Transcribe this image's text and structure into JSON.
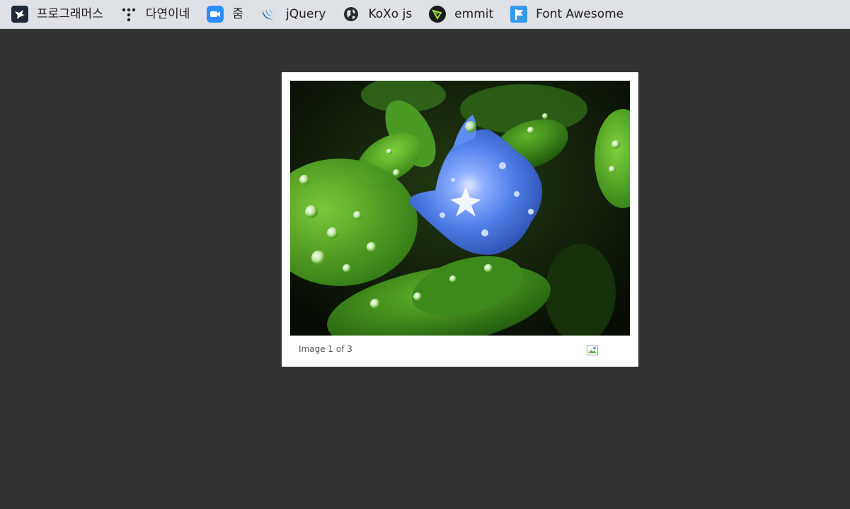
{
  "bookmarks": [
    {
      "label": "프로그래머스",
      "icon": "programmers-icon"
    },
    {
      "label": "다연이네",
      "icon": "dots-icon"
    },
    {
      "label": "줌",
      "icon": "zoom-icon"
    },
    {
      "label": "jQuery",
      "icon": "jquery-icon"
    },
    {
      "label": "KoXo js",
      "icon": "globe-icon"
    },
    {
      "label": "emmit",
      "icon": "emmet-icon"
    },
    {
      "label": "Font Awesome",
      "icon": "flag-icon"
    }
  ],
  "lightbox": {
    "caption": "Image 1 of 3",
    "image_subject": "blue flower with water droplets on green leaves",
    "close_icon": "broken-image-icon"
  },
  "colors": {
    "background": "#333333",
    "bookmarks_bar": "#dee1e6",
    "frame": "#ffffff"
  }
}
